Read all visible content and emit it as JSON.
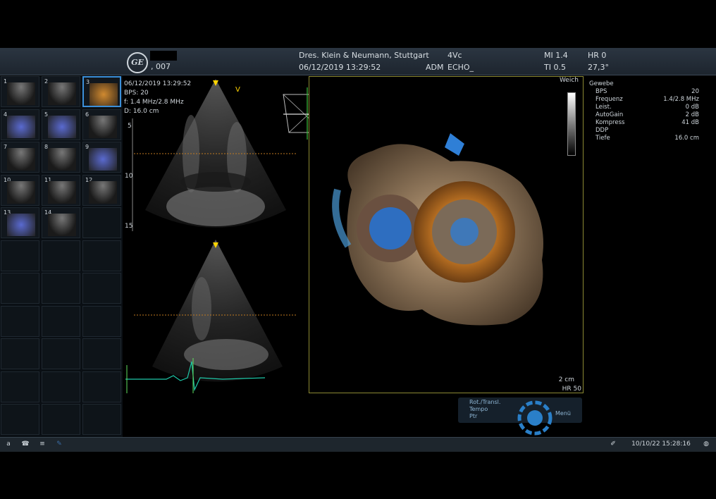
{
  "header": {
    "logo_text": "GE",
    "patient_id": ", 007",
    "institution": "Dres. Klein & Neumann, Stuttgart",
    "datetime": "06/12/2019 13:29:52",
    "probe": "4Vc",
    "mode": "ADM",
    "app": "ECHO_",
    "mi": "MI 1.4",
    "ti": "TI 0.5",
    "hr": "HR 0",
    "temp": "27,3°"
  },
  "thumbnails": [
    {
      "n": "1"
    },
    {
      "n": "2"
    },
    {
      "n": "3"
    },
    {
      "n": "4"
    },
    {
      "n": "5"
    },
    {
      "n": "6"
    },
    {
      "n": "7"
    },
    {
      "n": "8"
    },
    {
      "n": "9"
    },
    {
      "n": "10"
    },
    {
      "n": "11"
    },
    {
      "n": "12"
    },
    {
      "n": "13"
    },
    {
      "n": "14"
    }
  ],
  "image_info": {
    "datetime": "06/12/2019 13:29:52",
    "bps": "BPS: 20",
    "freq": "f: 1.4 MHz/2.8 MHz",
    "depth": "D: 16.0 cm",
    "depth_marks": [
      "5",
      "10",
      "15"
    ],
    "v_marker": "V"
  },
  "render": {
    "preset": "Weich",
    "scale": "2 cm",
    "hr": "HR 50"
  },
  "settings": {
    "title": "Gewebe",
    "rows": [
      {
        "label": "BPS",
        "value": "20"
      },
      {
        "label": "Frequenz",
        "value": "1.4/2.8 MHz"
      },
      {
        "label": "Leist.",
        "value": "0 dB"
      },
      {
        "label": "AutoGain",
        "value": "2 dB"
      },
      {
        "label": "Kompress",
        "value": "41 dB"
      },
      {
        "label": "DDP",
        "value": ""
      },
      {
        "label": "Tiefe",
        "value": "16.0 cm"
      }
    ]
  },
  "controls": {
    "line1": "Rot./Transl.",
    "line2": "Tempo",
    "line3": "Ptr",
    "menu": "Menü"
  },
  "taskbar": {
    "key_a": "a",
    "datetime": "10/10/22 15:28:16"
  }
}
